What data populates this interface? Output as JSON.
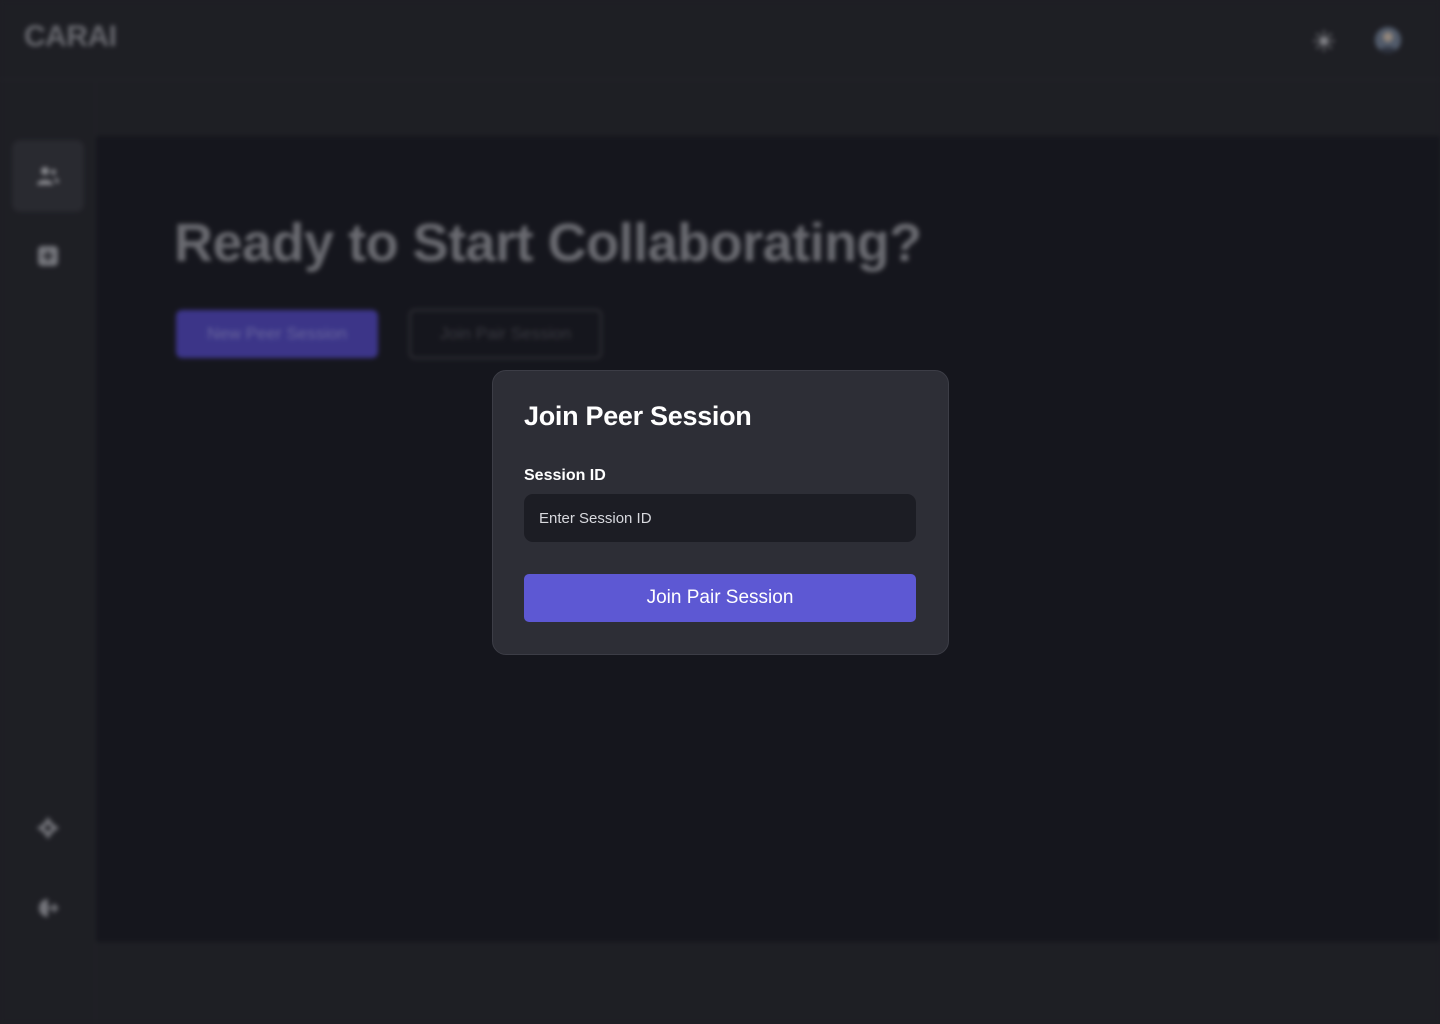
{
  "app": {
    "logo": "CARAI"
  },
  "header": {
    "theme_icon": "sun-icon",
    "avatar_icon": "user-avatar"
  },
  "sidebar": {
    "items": [
      {
        "name": "peer-sessions",
        "icon": "users-icon",
        "active": true
      },
      {
        "name": "add",
        "icon": "plus-square-icon",
        "active": false
      },
      {
        "name": "settings",
        "icon": "gear-icon",
        "active": false
      },
      {
        "name": "logout",
        "icon": "logout-icon",
        "active": false
      }
    ]
  },
  "main": {
    "title": "Ready to Start Collaborating?",
    "new_session_label": "New Peer Session",
    "join_session_label": "Join Pair Session"
  },
  "modal": {
    "title": "Join Peer Session",
    "field_label": "Session ID",
    "input_placeholder": "Enter Session ID",
    "input_value": "",
    "submit_label": "Join Pair Session"
  },
  "colors": {
    "accent": "#5d58d3",
    "modal_bg": "#2d2e36",
    "main_bg": "#1a1b23",
    "chrome_bg": "#26272d"
  }
}
